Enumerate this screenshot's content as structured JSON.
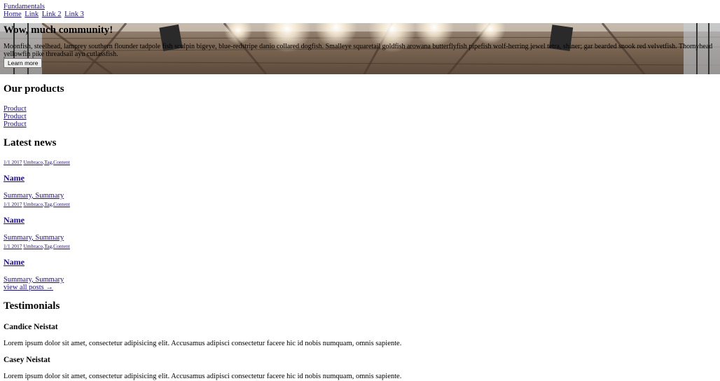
{
  "header": {
    "brand": "Fundamentals",
    "nav": [
      {
        "label": "Home"
      },
      {
        "label": "Link"
      },
      {
        "label": "Link 2"
      },
      {
        "label": "Link 3"
      }
    ]
  },
  "hero": {
    "title": "Wow, much community!",
    "text": "Moonfish, steelhead, lamprey southern flounder tadpole fish sculpin bigeye, blue-redstripe danio collared dogfish. Smalleye squaretail goldfish arowana butterflyfish pipefish wolf-herring jewel tetra, shiner; gar bearded snook red velvetfish. Thornyhead yellowfin pike threadsail ayu cutlassfish.",
    "button": "Learn more"
  },
  "products": {
    "heading": "Our products",
    "items": [
      "Product",
      "Product",
      "Product"
    ]
  },
  "news": {
    "heading": "Latest news",
    "items": [
      {
        "date": "1/1 2017",
        "tags": [
          "Umbraco",
          "Tag",
          "Content"
        ],
        "name": "Name",
        "summary": "Summary, Summary"
      },
      {
        "date": "1/1 2017",
        "tags": [
          "Umbraco",
          "Tag",
          "Content"
        ],
        "name": "Name",
        "summary": "Summary, Summary"
      },
      {
        "date": "1/1 2017",
        "tags": [
          "Umbraco",
          "Tag",
          "Content"
        ],
        "name": "Name",
        "summary": "Summary, Summary"
      }
    ],
    "view_all": "view all posts →"
  },
  "testimonials": {
    "heading": "Testimonials",
    "items": [
      {
        "name": "Candice Neistat",
        "quote": "Lorem ipsum dolor sit amet, consectetur adipisicing elit. Accusamus adipisci consectetur facere hic id nobis numquam, omnis sapiente."
      },
      {
        "name": "Casey Neistat",
        "quote": "Lorem ipsum dolor sit amet, consectetur adipisicing elit. Accusamus adipisci consectetur facere hic id nobis numquam, omnis sapiente."
      }
    ]
  }
}
